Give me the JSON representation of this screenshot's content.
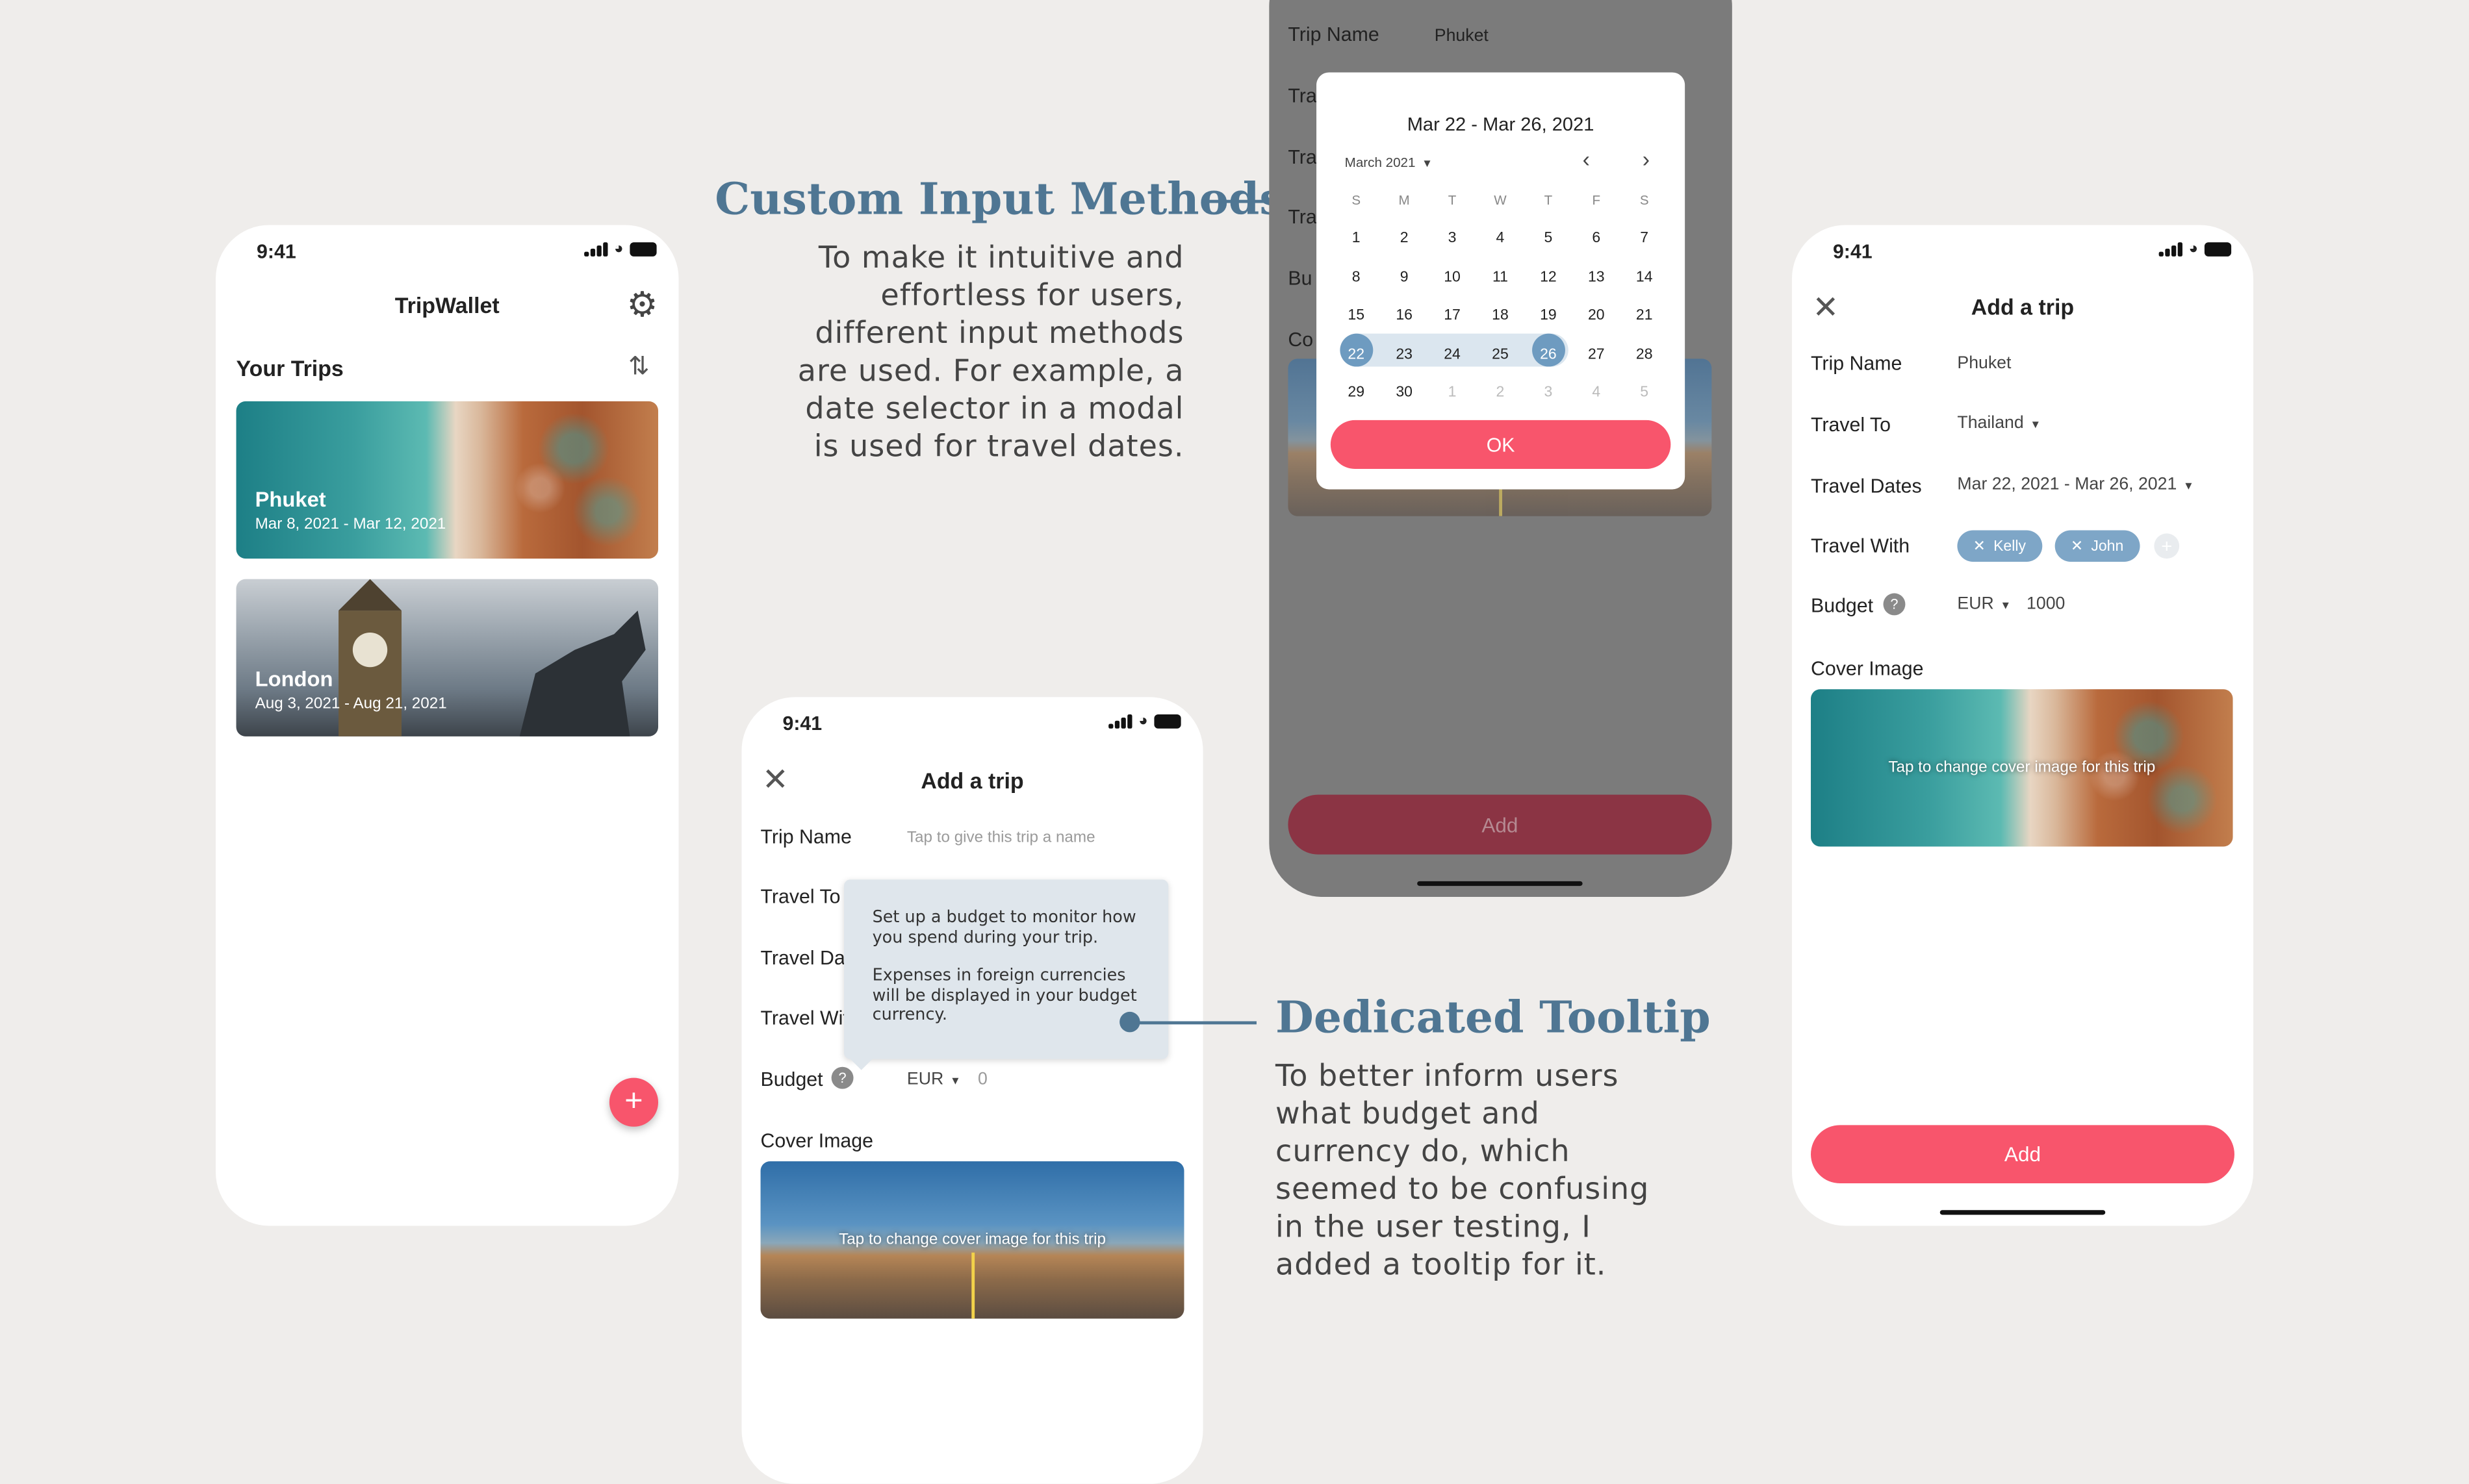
{
  "colors": {
    "accent": "#f8556c",
    "annotation": "#4f7693",
    "chip": "#7ea6c7",
    "background": "#efedeb"
  },
  "status": {
    "time": "9:41"
  },
  "screen1": {
    "app_title": "TripWallet",
    "section_title": "Your Trips",
    "trips": [
      {
        "name": "Phuket",
        "dates": "Mar 8, 2021 - Mar 12, 2021"
      },
      {
        "name": "London",
        "dates": "Aug 3, 2021 - Aug 21, 2021"
      }
    ],
    "fab_label": "+"
  },
  "annotation1": {
    "title": "Custom Input Methods",
    "lines": [
      "To make it intuitive and",
      "effortless for users,",
      "different input methods",
      "are used. For example, a",
      "date selector in a modal",
      "is used for travel dates."
    ]
  },
  "annotation2": {
    "title": "Dedicated Tooltip",
    "lines": [
      "To better inform users",
      "what budget and",
      "currency do, which",
      "seemed to be confusing",
      "in the user testing, I",
      "added a tooltip for it."
    ]
  },
  "screen2": {
    "title": "Add a trip",
    "labels": {
      "trip_name": "Trip Name",
      "travel_to": "Travel To",
      "travel_dates": "Travel Da",
      "travel_with": "Travel Wit",
      "budget": "Budget",
      "cover": "Cover Image"
    },
    "trip_name_placeholder": "Tap to give this trip a name",
    "currency": "EUR",
    "budget_value": "0",
    "tooltip_p1": "Set up a budget to monitor how you spend during your trip.",
    "tooltip_p2": "Expenses in foreign currencies will be displayed in your budget currency.",
    "cover_text": "Tap to change cover image for this trip"
  },
  "screen3": {
    "bg_labels": {
      "trip_name": "Trip Name",
      "trip_value": "Phuket",
      "l2": "Tra",
      "l3": "Tra",
      "l4": "Tra",
      "l5": "Bu",
      "l6": "Co"
    },
    "range_title": "Mar 22 - Mar 26, 2021",
    "month": "March 2021",
    "weekdays": [
      "S",
      "M",
      "T",
      "W",
      "T",
      "F",
      "S"
    ],
    "weeks": [
      [
        "1",
        "2",
        "3",
        "4",
        "5",
        "6",
        "7"
      ],
      [
        "8",
        "9",
        "10",
        "11",
        "12",
        "13",
        "14"
      ],
      [
        "15",
        "16",
        "17",
        "18",
        "19",
        "20",
        "21"
      ],
      [
        "22",
        "23",
        "24",
        "25",
        "26",
        "27",
        "28"
      ],
      [
        "29",
        "30",
        "1",
        "2",
        "3",
        "4",
        "5"
      ]
    ],
    "ok_label": "OK",
    "add_label": "Add"
  },
  "screen4": {
    "title": "Add a trip",
    "labels": {
      "trip_name": "Trip Name",
      "travel_to": "Travel To",
      "travel_dates": "Travel Dates",
      "travel_with": "Travel With",
      "budget": "Budget",
      "cover": "Cover Image"
    },
    "trip_name": "Phuket",
    "travel_to": "Thailand",
    "travel_dates": "Mar 22, 2021 - Mar 26, 2021",
    "companions": [
      "Kelly",
      "John"
    ],
    "currency": "EUR",
    "budget_value": "1000",
    "cover_text": "Tap to change cover image for this trip",
    "add_label": "Add"
  }
}
